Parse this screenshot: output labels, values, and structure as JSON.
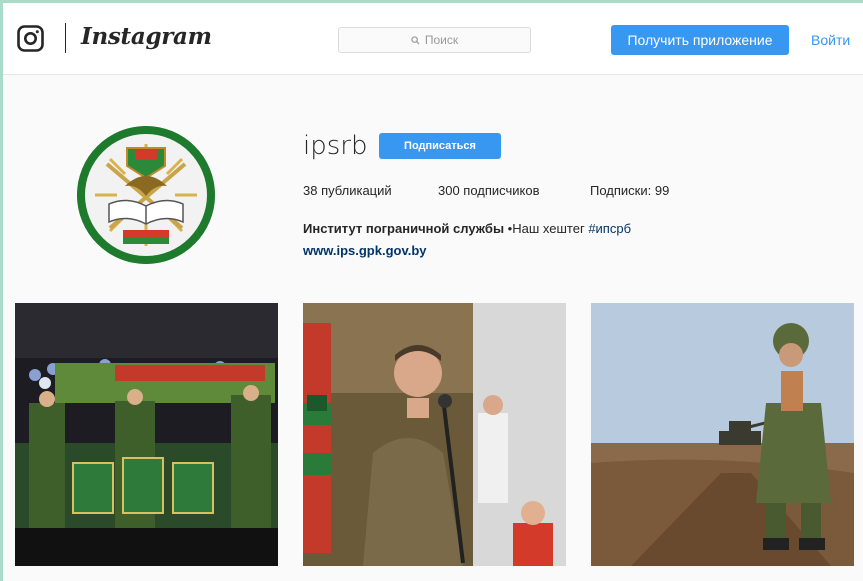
{
  "header": {
    "logo_icon": "instagram-camera-icon",
    "wordmark": "Instagram",
    "search_placeholder": "Поиск",
    "get_app_label": "Получить приложение",
    "login_label": "Войти"
  },
  "profile": {
    "username": "ipsrb",
    "follow_label": "Подписаться",
    "stats": {
      "posts": "38 публикаций",
      "followers": "300 подписчиков",
      "following": "Подписки: 99"
    },
    "bio_name": "Институт пограничной службы",
    "bio_separator": " •",
    "bio_text": "Наш хештег ",
    "bio_hashtag": "#ипсрб",
    "website": "www.ips.gpk.gov.by"
  },
  "photos": [
    {
      "icon": "military-band-photo"
    },
    {
      "icon": "soldier-singing-photo"
    },
    {
      "icon": "soldier-field-tank-photo"
    }
  ],
  "colors": {
    "accent": "#3897f0",
    "link": "#003569",
    "background": "#fafafa",
    "outer": "#a8dcc8"
  }
}
